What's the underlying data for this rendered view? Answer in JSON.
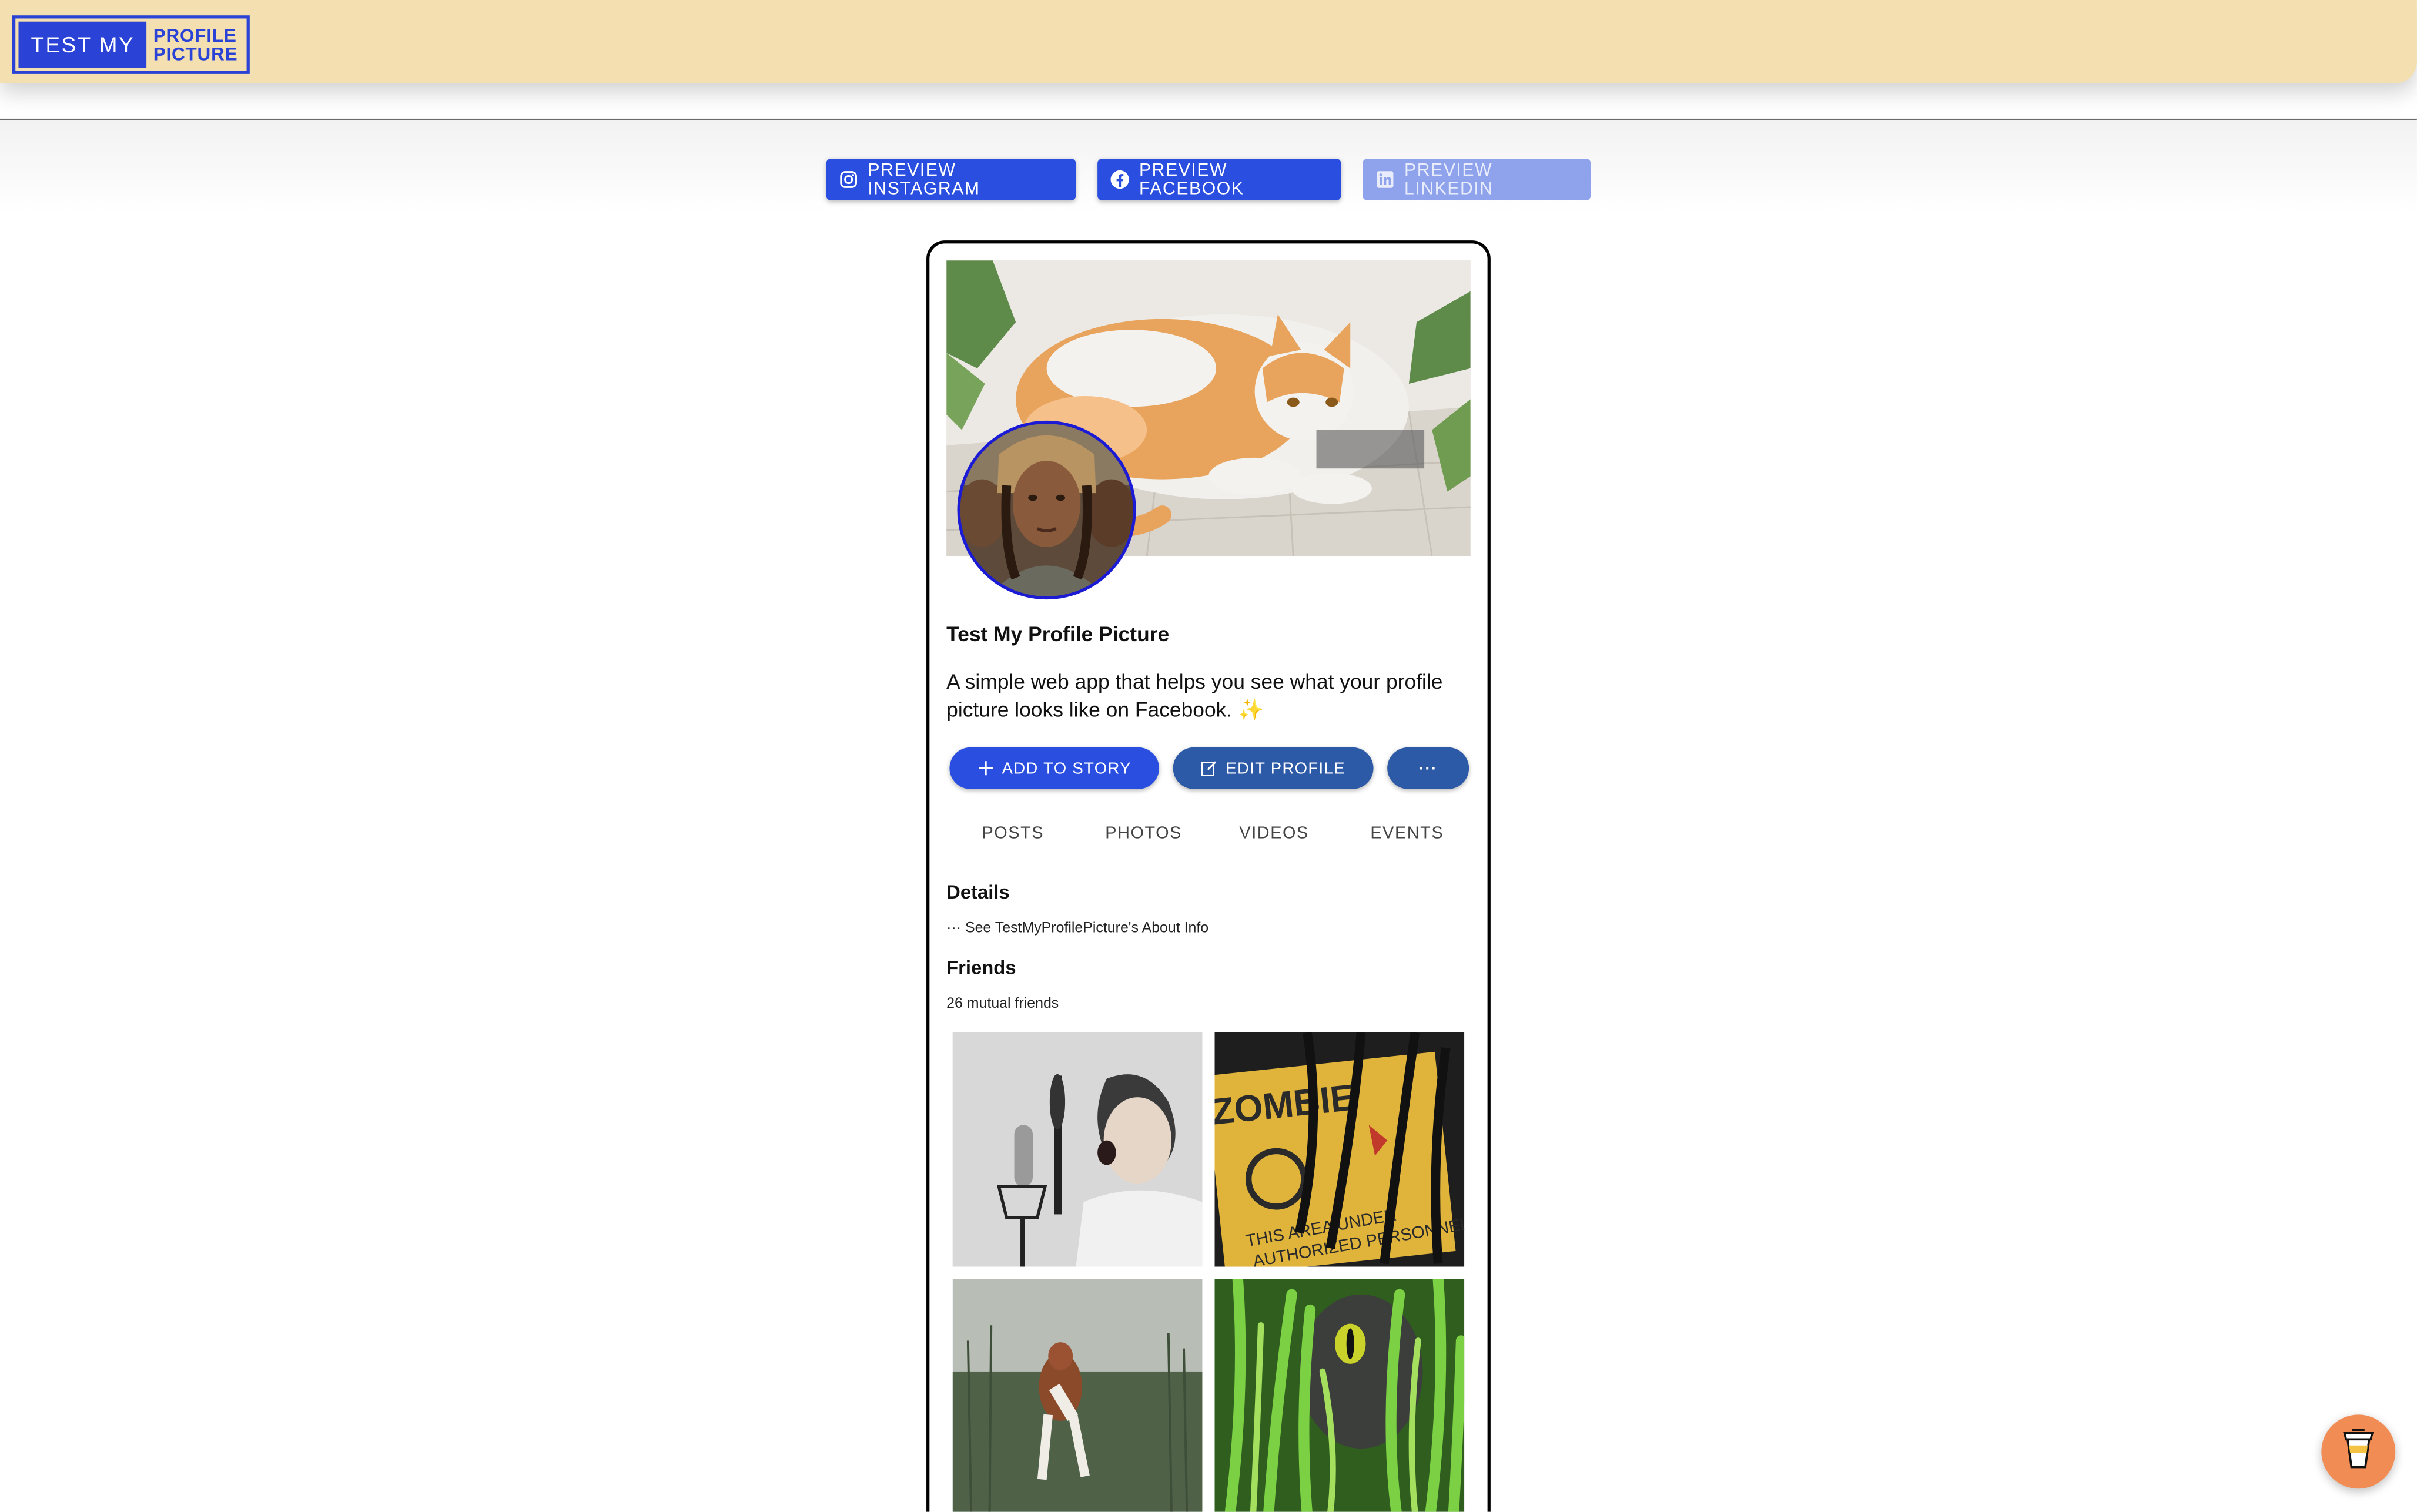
{
  "logo": {
    "left_text": "TEST MY",
    "right_line1": "PROFILE",
    "right_line2": "PICTURE"
  },
  "preview_buttons": [
    {
      "label": "PREVIEW INSTAGRAM",
      "icon": "instagram-icon",
      "enabled": true
    },
    {
      "label": "PREVIEW FACEBOOK",
      "icon": "facebook-icon",
      "enabled": true
    },
    {
      "label": "PREVIEW LINKEDIN",
      "icon": "linkedin-icon",
      "enabled": false
    }
  ],
  "profile": {
    "name": "Test My Profile Picture",
    "bio": "A simple web app that helps you see what your profile picture looks like on Facebook. ✨",
    "actions": {
      "add_story": "ADD TO STORY",
      "edit_profile": "EDIT PROFILE",
      "more": "···"
    },
    "tabs": [
      "POSTS",
      "PHOTOS",
      "VIDEOS",
      "EVENTS"
    ],
    "details_title": "Details",
    "details_link": "··· See TestMyProfilePicture's About Info",
    "friends_title": "Friends",
    "mutual_friends": "26 mutual friends"
  },
  "colors": {
    "header_bg": "#f4dfb0",
    "brand_blue": "#2a4fe0",
    "disabled_blue": "#8fa3ec",
    "coffee_button": "#f08c54"
  }
}
